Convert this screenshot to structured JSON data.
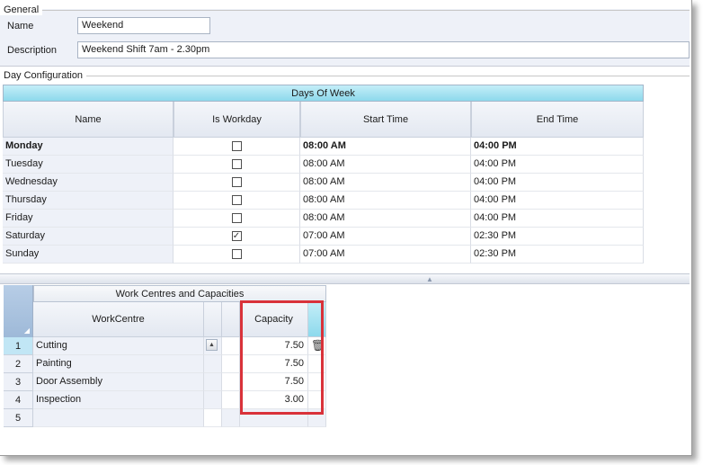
{
  "general": {
    "legend": "General",
    "name_label": "Name",
    "name_value": "Weekend",
    "description_label": "Description",
    "description_value": "Weekend Shift 7am - 2.30pm"
  },
  "day_config": {
    "legend": "Day Configuration",
    "grid_title": "Days Of Week",
    "columns": [
      "Name",
      "Is Workday",
      "Start Time",
      "End Time"
    ],
    "rows": [
      {
        "name": "Monday",
        "workday": "",
        "start": "08:00 AM",
        "end": "04:00 PM"
      },
      {
        "name": "Tuesday",
        "workday": "",
        "start": "08:00 AM",
        "end": "04:00 PM"
      },
      {
        "name": "Wednesday",
        "workday": "",
        "start": "08:00 AM",
        "end": "04:00 PM"
      },
      {
        "name": "Thursday",
        "workday": "",
        "start": "08:00 AM",
        "end": "04:00 PM"
      },
      {
        "name": "Friday",
        "workday": "",
        "start": "08:00 AM",
        "end": "04:00 PM"
      },
      {
        "name": "Saturday",
        "workday": "✓",
        "start": "07:00 AM",
        "end": "02:30 PM"
      },
      {
        "name": "Sunday",
        "workday": "",
        "start": "07:00 AM",
        "end": "02:30 PM"
      }
    ]
  },
  "work_centres": {
    "title": "Work Centres and Capacities",
    "columns": [
      "WorkCentre",
      "Capacity"
    ],
    "rows": [
      {
        "num": "1",
        "workcentre": "Cutting",
        "capacity": "7.50"
      },
      {
        "num": "2",
        "workcentre": "Painting",
        "capacity": "7.50"
      },
      {
        "num": "3",
        "workcentre": "Door Assembly",
        "capacity": "7.50"
      },
      {
        "num": "4",
        "workcentre": "Inspection",
        "capacity": "3.00"
      },
      {
        "num": "5",
        "workcentre": "",
        "capacity": ""
      }
    ],
    "icons": {
      "scroll": "scroll-up-icon",
      "delete": "trash-icon"
    }
  },
  "colors": {
    "accent_header": "#8dd9ec",
    "highlight": "#d9323a",
    "selected_row": "#c1e6f5"
  }
}
